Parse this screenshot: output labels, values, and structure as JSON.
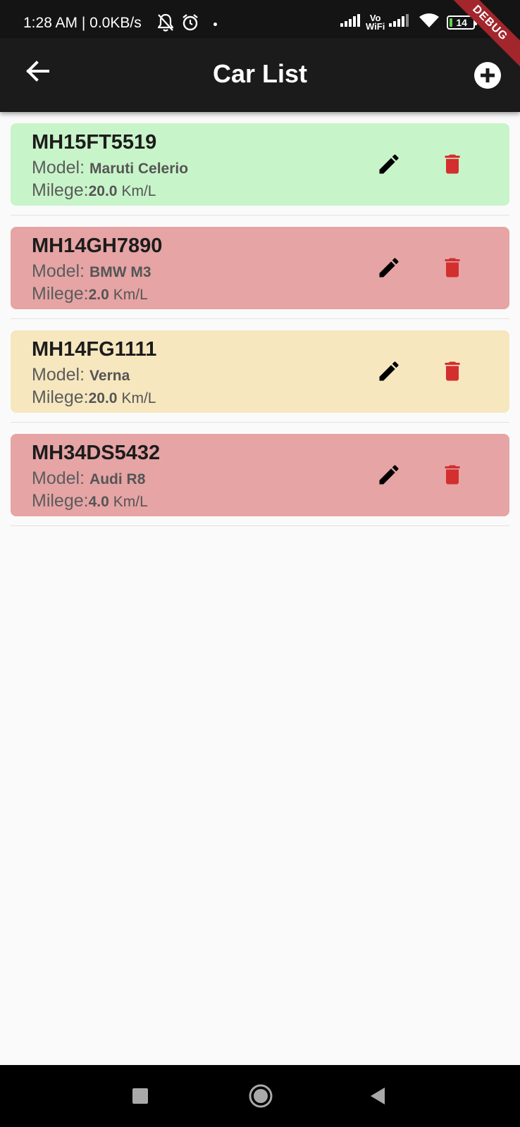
{
  "status_bar": {
    "time_network": "1:28 AM | 0.0KB/s",
    "vowifi_top": "Vo",
    "vowifi_bottom": "WiFi",
    "battery_level": "14",
    "battery_fraction": 0.14,
    "icons": [
      "mute-bell-icon",
      "alarm-icon",
      "signal-icon",
      "signal-icon",
      "wifi-icon",
      "battery-icon",
      "charging-icon"
    ]
  },
  "debug_banner": "DEBUG",
  "app_bar": {
    "title": "Car List",
    "back_icon": "arrow-back-icon",
    "add_icon": "add-circle-icon"
  },
  "labels": {
    "model": "Model:",
    "milege": "Milege:",
    "unit": "Km/L"
  },
  "cars": [
    {
      "plate": "MH15FT5519",
      "model": "Maruti Celerio",
      "milege": "20.0",
      "card_color": "#c8f4c9"
    },
    {
      "plate": "MH14GH7890",
      "model": "BMW M3",
      "milege": "2.0",
      "card_color": "#e6a4a5"
    },
    {
      "plate": "MH14FG1111",
      "model": "Verna",
      "milege": "20.0",
      "card_color": "#f6e7bf"
    },
    {
      "plate": "MH34DS5432",
      "model": "Audi R8",
      "milege": "4.0",
      "card_color": "#e6a4a5"
    }
  ],
  "colors": {
    "edit_icon": "#000000",
    "delete_icon": "#d32f2f",
    "app_bar": "#1b1b1b",
    "background": "#fafafa"
  },
  "nav_bar": {
    "icons": [
      "recents-icon",
      "home-icon",
      "back-triangle-icon"
    ]
  }
}
